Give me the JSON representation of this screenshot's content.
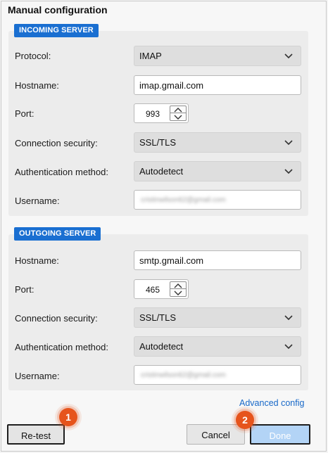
{
  "dialog": {
    "title": "Manual configuration"
  },
  "incoming": {
    "section_label": "INCOMING SERVER",
    "protocol_label": "Protocol:",
    "protocol_value": "IMAP",
    "hostname_label": "Hostname:",
    "hostname_value": "imap.gmail.com",
    "port_label": "Port:",
    "port_value": "993",
    "security_label": "Connection security:",
    "security_value": "SSL/TLS",
    "auth_label": "Authentication method:",
    "auth_value": "Autodetect",
    "username_label": "Username:",
    "username_value": "cristinwilson62@gmail.com"
  },
  "outgoing": {
    "section_label": "OUTGOING SERVER",
    "hostname_label": "Hostname:",
    "hostname_value": "smtp.gmail.com",
    "port_label": "Port:",
    "port_value": "465",
    "security_label": "Connection security:",
    "security_value": "SSL/TLS",
    "auth_label": "Authentication method:",
    "auth_value": "Autodetect",
    "username_label": "Username:",
    "username_value": "cristinwilson62@gmail.com"
  },
  "links": {
    "advanced_config": "Advanced config"
  },
  "buttons": {
    "retest": "Re-test",
    "cancel": "Cancel",
    "done": "Done"
  },
  "markers": {
    "one": "1",
    "two": "2"
  },
  "colors": {
    "accent": "#1a6fd1",
    "link": "#1768c8",
    "marker": "#e6541c",
    "done_bg": "#b3d4f6"
  },
  "icons": {
    "select_arrow": "chevron-down-icon",
    "spin_up": "chevron-up-icon",
    "spin_down": "chevron-down-icon"
  }
}
